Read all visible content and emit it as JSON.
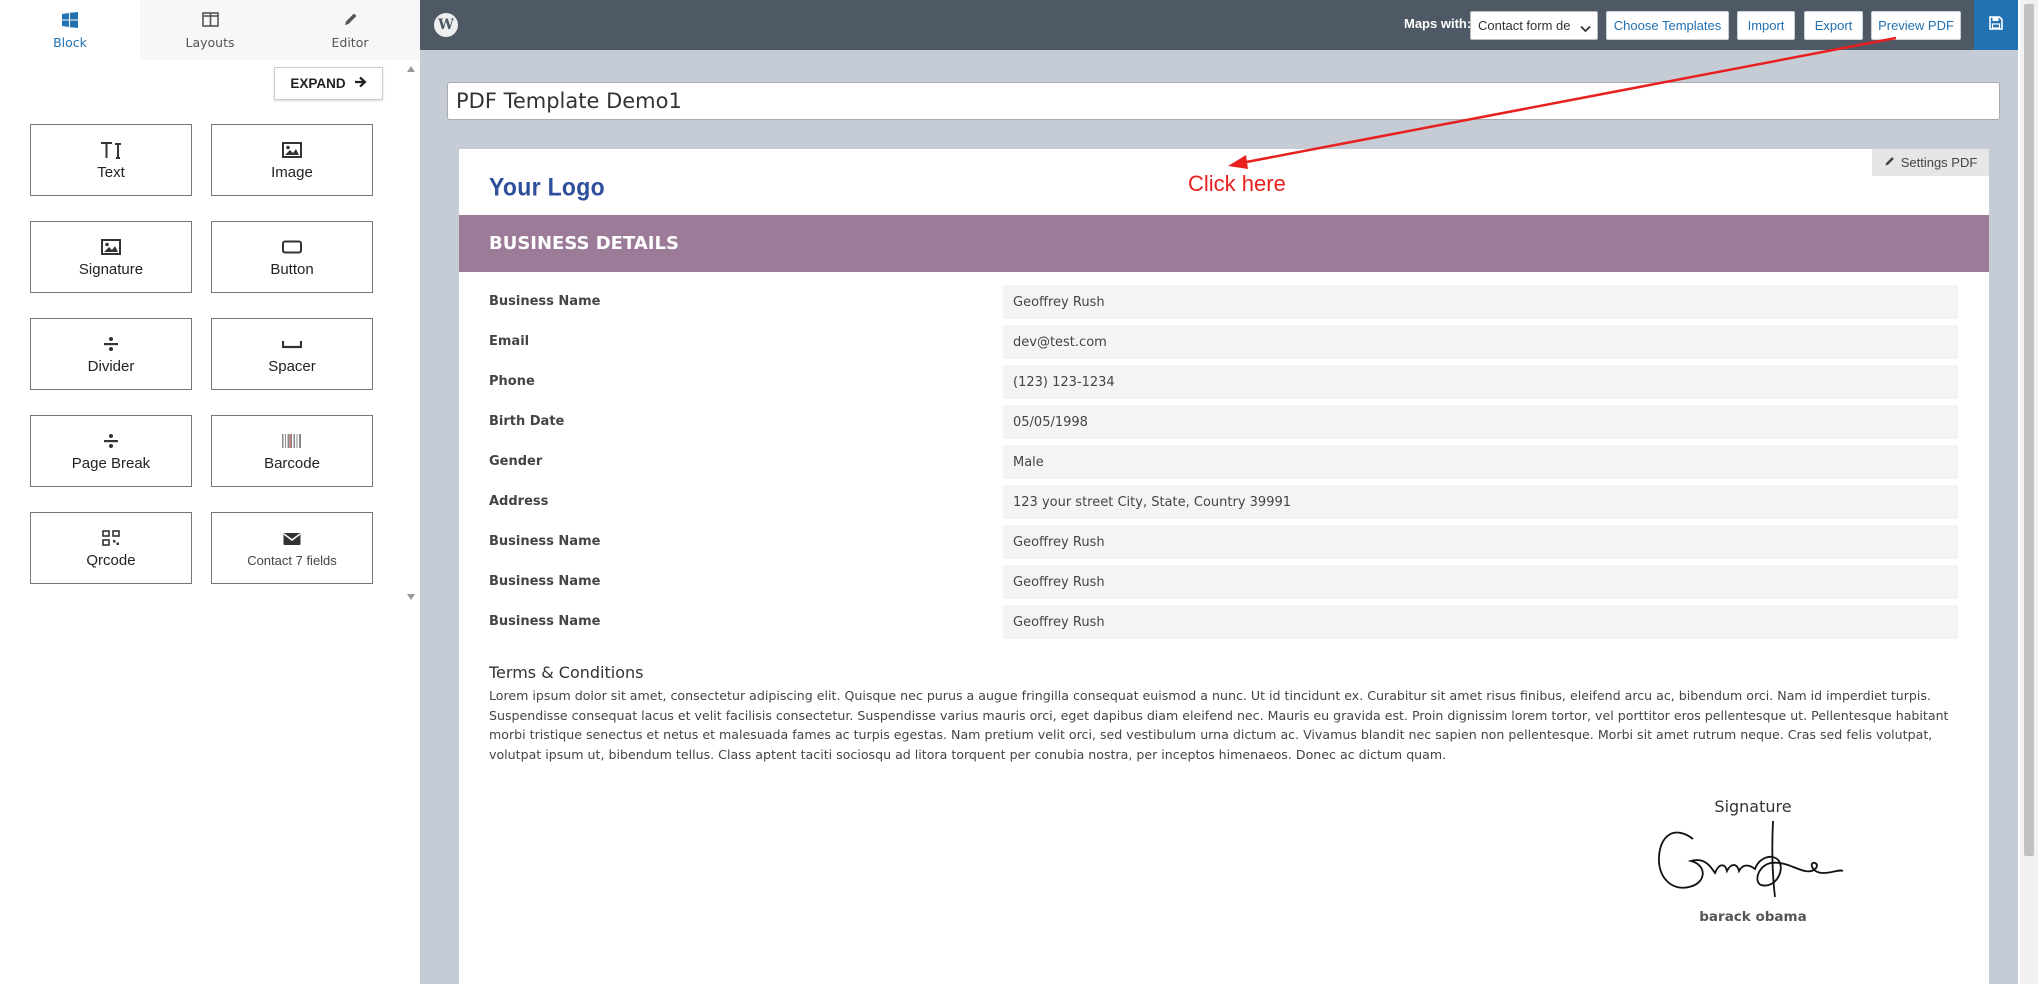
{
  "sidebar": {
    "tabs": [
      {
        "label": "Block",
        "icon": "windows-grid-icon",
        "active": true
      },
      {
        "label": "Layouts",
        "icon": "columns-icon",
        "active": false
      },
      {
        "label": "Editor",
        "icon": "pencil-icon",
        "active": false
      }
    ],
    "expand_label": "EXPAND",
    "blocks": [
      {
        "label": "Text",
        "icon": "text-icon"
      },
      {
        "label": "Image",
        "icon": "image-icon"
      },
      {
        "label": "Signature",
        "icon": "signature-image-icon"
      },
      {
        "label": "Button",
        "icon": "button-icon"
      },
      {
        "label": "Divider",
        "icon": "divider-icon"
      },
      {
        "label": "Spacer",
        "icon": "spacer-icon"
      },
      {
        "label": "Page Break",
        "icon": "page-break-icon"
      },
      {
        "label": "Barcode",
        "icon": "barcode-icon"
      },
      {
        "label": "Qrcode",
        "icon": "qrcode-icon"
      },
      {
        "label": "Contact 7 fields",
        "icon": "envelope-icon"
      }
    ]
  },
  "topbar": {
    "maps_label": "Maps with:",
    "maps_select_value": "Contact form de",
    "buttons": [
      "Choose Templates",
      "Import",
      "Export",
      "Preview PDF"
    ],
    "accent_color": "#2271b1",
    "bar_color": "#4e5965"
  },
  "editor": {
    "template_title": "PDF Template Demo1",
    "settings_label": "Settings PDF",
    "logo_text": "Your Logo",
    "logo_color": "#2d4f9c",
    "section_title": "BUSINESS DETAILS",
    "section_color": "#9c7b99",
    "fields": [
      {
        "label": "Business Name",
        "value": "Geoffrey Rush"
      },
      {
        "label": "Email",
        "value": "dev@test.com"
      },
      {
        "label": "Phone",
        "value": "(123) 123-1234"
      },
      {
        "label": "Birth Date",
        "value": "05/05/1998"
      },
      {
        "label": "Gender",
        "value": "Male"
      },
      {
        "label": "Address",
        "value": "123 your street City, State, Country 39991"
      },
      {
        "label": "Business Name",
        "value": "Geoffrey Rush"
      },
      {
        "label": "Business Name",
        "value": "Geoffrey Rush"
      },
      {
        "label": "Business Name",
        "value": "Geoffrey Rush"
      }
    ],
    "terms_title": "Terms & Conditions",
    "terms_body": "Lorem ipsum dolor sit amet, consectetur adipiscing elit. Quisque nec purus a augue fringilla consequat euismod a nunc. Ut id tincidunt ex. Curabitur sit amet risus finibus, eleifend arcu ac, bibendum orci. Nam id imperdiet turpis. Suspendisse consequat lacus et velit facilisis consectetur. Suspendisse varius mauris orci, eget dapibus diam eleifend nec. Mauris eu gravida est. Proin dignissim lorem tortor, vel porttitor eros pellentesque ut. Pellentesque habitant morbi tristique senectus et netus et malesuada fames ac turpis egestas. Nam pretium velit orci, sed vestibulum urna dictum ac. Vivamus blandit nec sapien non pellentesque. Morbi sit amet rutrum neque. Cras sed felis volutpat, volutpat ipsum ut, bibendum tellus. Class aptent taciti sociosqu ad litora torquent per conubia nostra, per inceptos himenaeos. Donec ac dictum quam.",
    "signature_title": "Signature",
    "signature_name": "barack obama"
  },
  "annotation": {
    "text": "Click here",
    "color": "#e8201f"
  }
}
